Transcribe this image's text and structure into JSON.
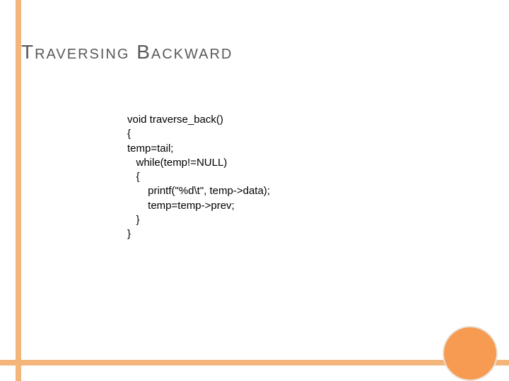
{
  "slide": {
    "title": "Traversing Backward",
    "code": {
      "l1": "void traverse_back()",
      "l2": "{",
      "l3": "temp=tail;",
      "l4": "   while(temp!=NULL)",
      "l5": "   {",
      "l6": "       printf(\"%d\\t\", temp->data);",
      "l7": "       temp=temp->prev;",
      "l8": "   }",
      "l9": "}"
    }
  }
}
